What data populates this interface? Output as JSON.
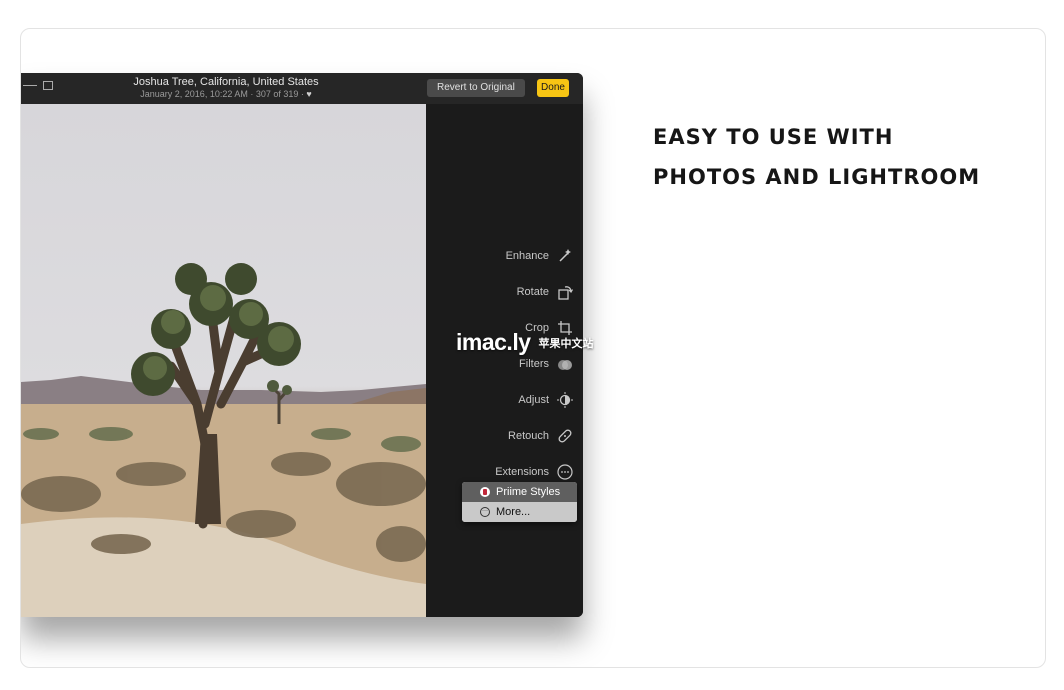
{
  "titlebar": {
    "title": "Joshua Tree, California, United States",
    "subtitle": "January 2, 2016, 10:22 AM  ·  307 of 319  ·",
    "revert_label": "Revert to Original",
    "done_label": "Done"
  },
  "sidebar": {
    "tools": [
      {
        "label": "Enhance",
        "icon": "magic-wand-icon"
      },
      {
        "label": "Rotate",
        "icon": "rotate-icon"
      },
      {
        "label": "Crop",
        "icon": "crop-icon"
      },
      {
        "label": "Filters",
        "icon": "filters-icon"
      },
      {
        "label": "Adjust",
        "icon": "adjust-icon"
      },
      {
        "label": "Retouch",
        "icon": "bandage-icon"
      },
      {
        "label": "Extensions",
        "icon": "more-circle-icon"
      }
    ]
  },
  "extensions_menu": {
    "items": [
      {
        "label": "Priime Styles",
        "selected": true
      },
      {
        "label": "More...",
        "selected": false
      }
    ]
  },
  "marketing": {
    "line1": "EASY TO USE WITH",
    "line2": "PHOTOS AND LIGHTROOM"
  },
  "watermark": {
    "main": "imac.ly",
    "sub": "苹果中文站"
  },
  "colors": {
    "done_button": "#f7c514",
    "sidebar_bg": "#1b1b1b"
  }
}
